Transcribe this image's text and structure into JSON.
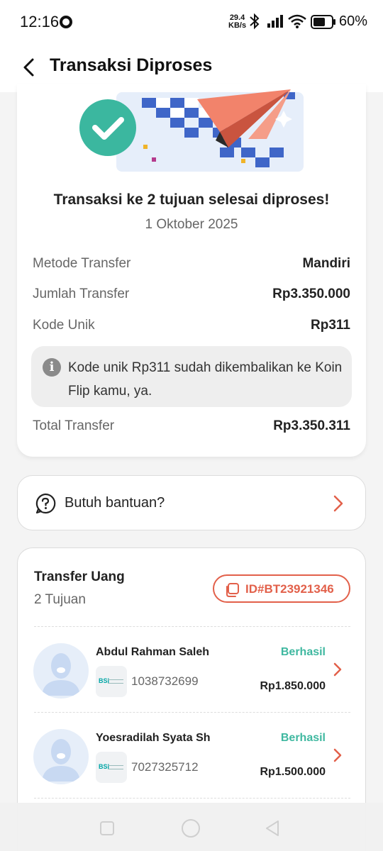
{
  "status_bar": {
    "time": "12:16",
    "speed_value": "29.4",
    "speed_unit": "KB/s",
    "battery": "60%"
  },
  "header": {
    "title": "Transaksi Diproses",
    "back_icon": "chevron-left-icon"
  },
  "summary": {
    "title": "Transaksi ke 2 tujuan selesai diproses!",
    "date": "1 Oktober 2025",
    "rows": [
      {
        "label": "Metode Transfer",
        "value": "Mandiri"
      },
      {
        "label": "Jumlah Transfer",
        "value": "Rp3.350.000"
      },
      {
        "label": "Kode Unik",
        "value": "Rp311"
      }
    ],
    "info_icon": "info-icon",
    "info_text": "Kode unik Rp311 sudah dikembalikan ke Koin Flip kamu, ya.",
    "total": {
      "label": "Total Transfer",
      "value": "Rp3.350.311"
    }
  },
  "help": {
    "label": "Butuh bantuan?",
    "icon": "question-icon"
  },
  "transfer": {
    "title": "Transfer Uang",
    "subtitle": "2 Tujuan",
    "id": "ID#BT23921346",
    "recipients": [
      {
        "name": "Abdul Rahman Saleh",
        "bank_logo_text": "BSI",
        "account": "1038732699",
        "status": "Berhasil",
        "amount": "Rp1.850.000"
      },
      {
        "name": "Yoesradilah Syata Sh",
        "bank_logo_text": "BSI",
        "account": "7027325712",
        "status": "Berhasil",
        "amount": "Rp1.500.000"
      }
    ]
  },
  "colors": {
    "accent": "#e2604a",
    "success": "#3fb8a0",
    "success_badge": "#3bb79f"
  }
}
